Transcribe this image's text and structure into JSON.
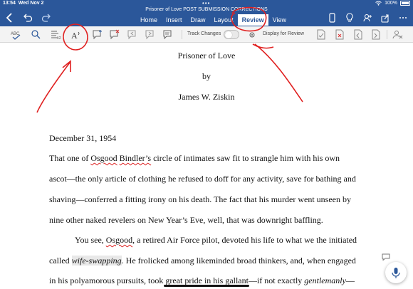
{
  "status": {
    "time": "13:54",
    "date": "Wed Nov 2",
    "battery": "100%"
  },
  "title": "Prisoner of Love POST SUBMISSION CORRECTIONS",
  "tabs": [
    {
      "label": "Home"
    },
    {
      "label": "Insert"
    },
    {
      "label": "Draw"
    },
    {
      "label": "Layout"
    },
    {
      "label": "Review",
      "active": true
    },
    {
      "label": "View"
    }
  ],
  "ribbon": {
    "spelling_label": "ABC",
    "read_aloud_label": "A",
    "track_changes_label": "Track Changes",
    "track_changes_on": false,
    "display_label": "Display for Review"
  },
  "document": {
    "title": "Prisoner of Love",
    "by": "by",
    "author": "James W. Ziskin",
    "date": "December 31, 1954",
    "lines": [
      {
        "a": "That one of ",
        "b": "Osgood",
        "c": " ",
        "d": "Bindler’s",
        "e": " circle of intimates saw fit to strangle him with his own"
      },
      {
        "a": "ascot—the only article of clothing he refused to doff for any activity, save for bathing and"
      },
      {
        "a": "shaving—conferred a fitting irony on his death. The fact that his murder went unseen by"
      },
      {
        "a": "nine other naked revelers on New Year’s Eve, well, that was downright baffling."
      },
      {
        "a": "You see, ",
        "b": "Osgood",
        "c": ", a retired Air Force pilot, devoted his life to what we the initiated"
      },
      {
        "a": "called ",
        "b": "wife-swapping",
        "c": ". He frolicked among likeminded broad thinkers, and, when engaged"
      },
      {
        "a": "in his polyamorous pursuits, took great pride in his gallant—if not exactly ",
        "b": "gentlemanly",
        "c": "—"
      }
    ]
  },
  "colors": {
    "accent": "#2b579a",
    "annotation": "#e02020",
    "spelling": "#d22222"
  },
  "icons": [
    "back-arrow-icon",
    "undo-icon",
    "redo-icon",
    "phone-icon",
    "lightbulb-icon",
    "person-add-icon",
    "share-icon",
    "more-icon",
    "comment-icon",
    "microphone-icon"
  ]
}
